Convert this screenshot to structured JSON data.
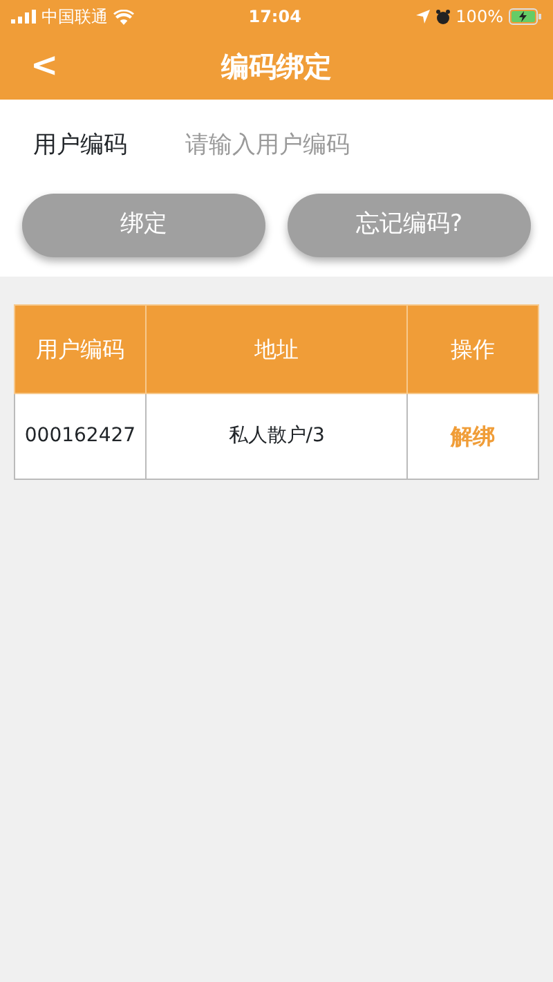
{
  "status_bar": {
    "carrier": "中国联通",
    "time": "17:04",
    "battery": "100%"
  },
  "nav": {
    "back": "<",
    "title": "编码绑定"
  },
  "form": {
    "label": "用户编码",
    "placeholder": "请输入用户编码"
  },
  "buttons": [
    "绑定",
    "忘记编码?"
  ],
  "table": {
    "columns": [
      "用户编码",
      "地址",
      "操作"
    ],
    "rows": [
      {
        "code": "000162427",
        "address": "私人散户/3",
        "action": "解绑"
      }
    ]
  }
}
